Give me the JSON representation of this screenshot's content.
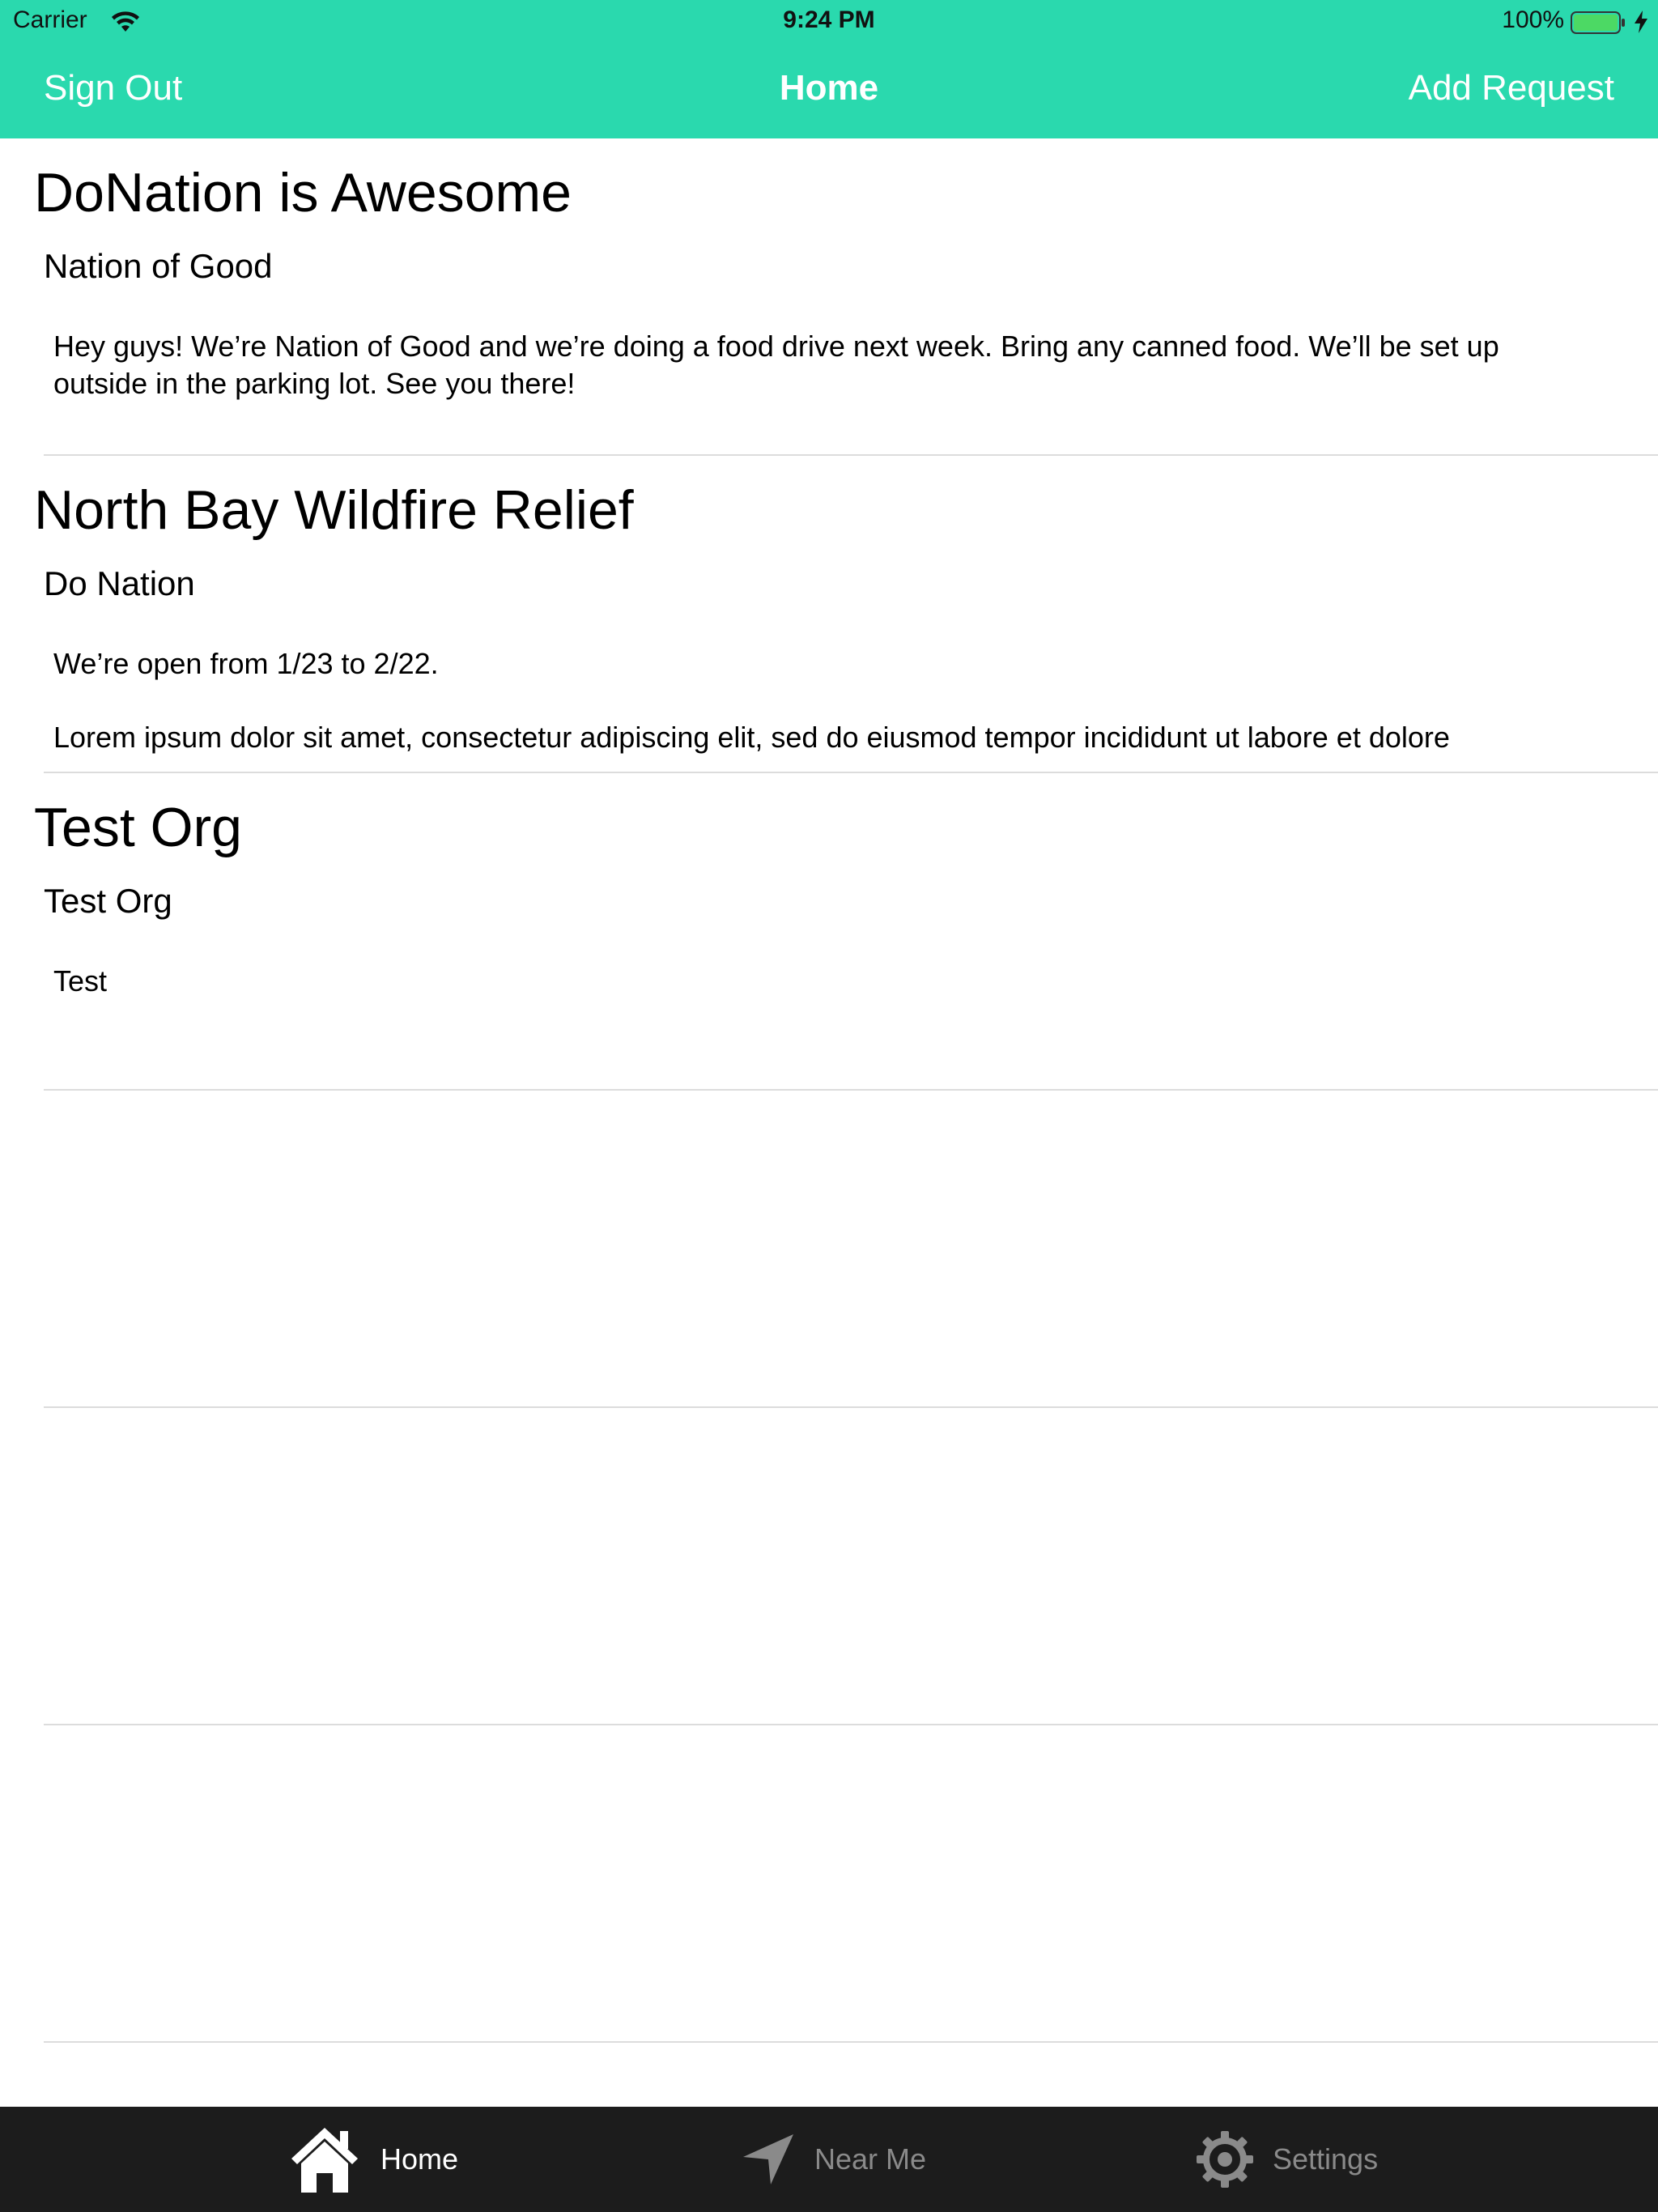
{
  "status_bar": {
    "carrier": "Carrier",
    "time": "9:24 PM",
    "battery_percent": "100%",
    "battery_level": 1.0
  },
  "nav_bar": {
    "left_label": "Sign Out",
    "title": "Home",
    "right_label": "Add Request"
  },
  "requests": [
    {
      "title": "DoNation is Awesome",
      "org": "Nation of Good",
      "paragraphs": [
        "Hey guys! We’re Nation of Good and we’re doing a food drive next week. Bring any canned food. We’ll be set up outside in the parking lot. See you there!"
      ]
    },
    {
      "title": "North Bay Wildfire Relief",
      "org": "Do Nation",
      "paragraphs": [
        "We’re open from 1/23 to 2/22.",
        "Lorem ipsum dolor sit amet, consectetur adipiscing elit, sed do eiusmod tempor incididunt ut labore et dolore"
      ]
    },
    {
      "title": "Test Org",
      "org": "Test Org",
      "paragraphs": [
        "Test"
      ]
    }
  ],
  "tab_bar": {
    "tabs": [
      {
        "label": "Home",
        "icon": "house-icon",
        "active": true
      },
      {
        "label": "Near Me",
        "icon": "location-arrow-icon",
        "active": false
      },
      {
        "label": "Settings",
        "icon": "gear-icon",
        "active": false
      }
    ]
  },
  "colors": {
    "accent": "#2ad9ae",
    "tab_bar_bg": "#1c1c1c",
    "tab_inactive": "#8a8a8a",
    "separator": "#dcdcdc",
    "battery_fill": "#4cd964"
  }
}
